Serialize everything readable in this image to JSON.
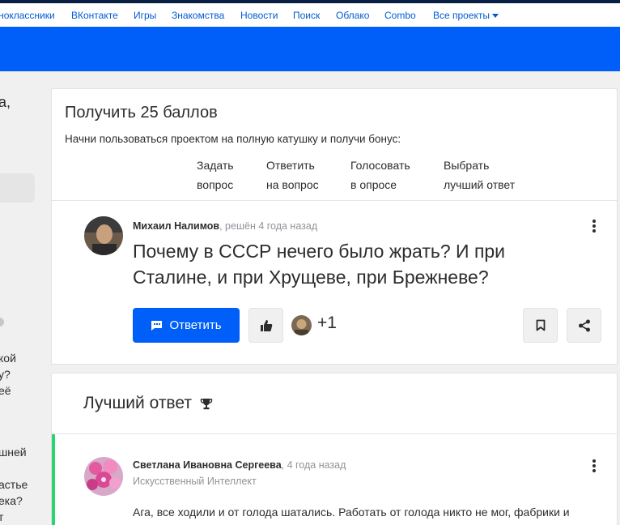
{
  "portal_nav": {
    "items": [
      "Одноклассники",
      "ВКонтакте",
      "Игры",
      "Знакомства",
      "Новости",
      "Поиск",
      "Облако",
      "Combo"
    ],
    "all_projects": "Все проекты"
  },
  "left_fragments": [
    "а,",
    "кой",
    "у?",
    "её",
    "шней",
    "астье",
    "ека?",
    "т"
  ],
  "bonus": {
    "title": "Получить 25 баллов",
    "description": "Начни пользоваться проектом на полную катушку и получи бонус:",
    "items": [
      {
        "line1": "Задать",
        "line2": "вопрос"
      },
      {
        "line1": "Ответить",
        "line2": "на вопрос"
      },
      {
        "line1": "Голосовать",
        "line2": "в опросе"
      },
      {
        "line1": "Выбрать",
        "line2": "лучший ответ"
      }
    ]
  },
  "question": {
    "author": "Михаил Налимов",
    "meta": ", решён 4 года назад",
    "text": "Почему в СССР нечего было жрать? И при Сталине, и при Хрущеве, при Брежневе?",
    "answer_button": "Ответить",
    "likes": "+1"
  },
  "best_answer": {
    "heading": "Лучший ответ",
    "author": "Светлана Ивановна Сергеева",
    "meta": ", 4 года назад",
    "rank": "Искусственный Интеллект",
    "text": "Ага, все ходили и от голода шатались. Работать от голода никто не мог, фабрики и заводы, колхозы и совхозы, миллионеры, все, все не работали !!!Караул!!! Это"
  },
  "colors": {
    "brand_blue": "#005ff9",
    "link_blue": "#005bd1",
    "best_answer_green": "#2bd46f"
  }
}
